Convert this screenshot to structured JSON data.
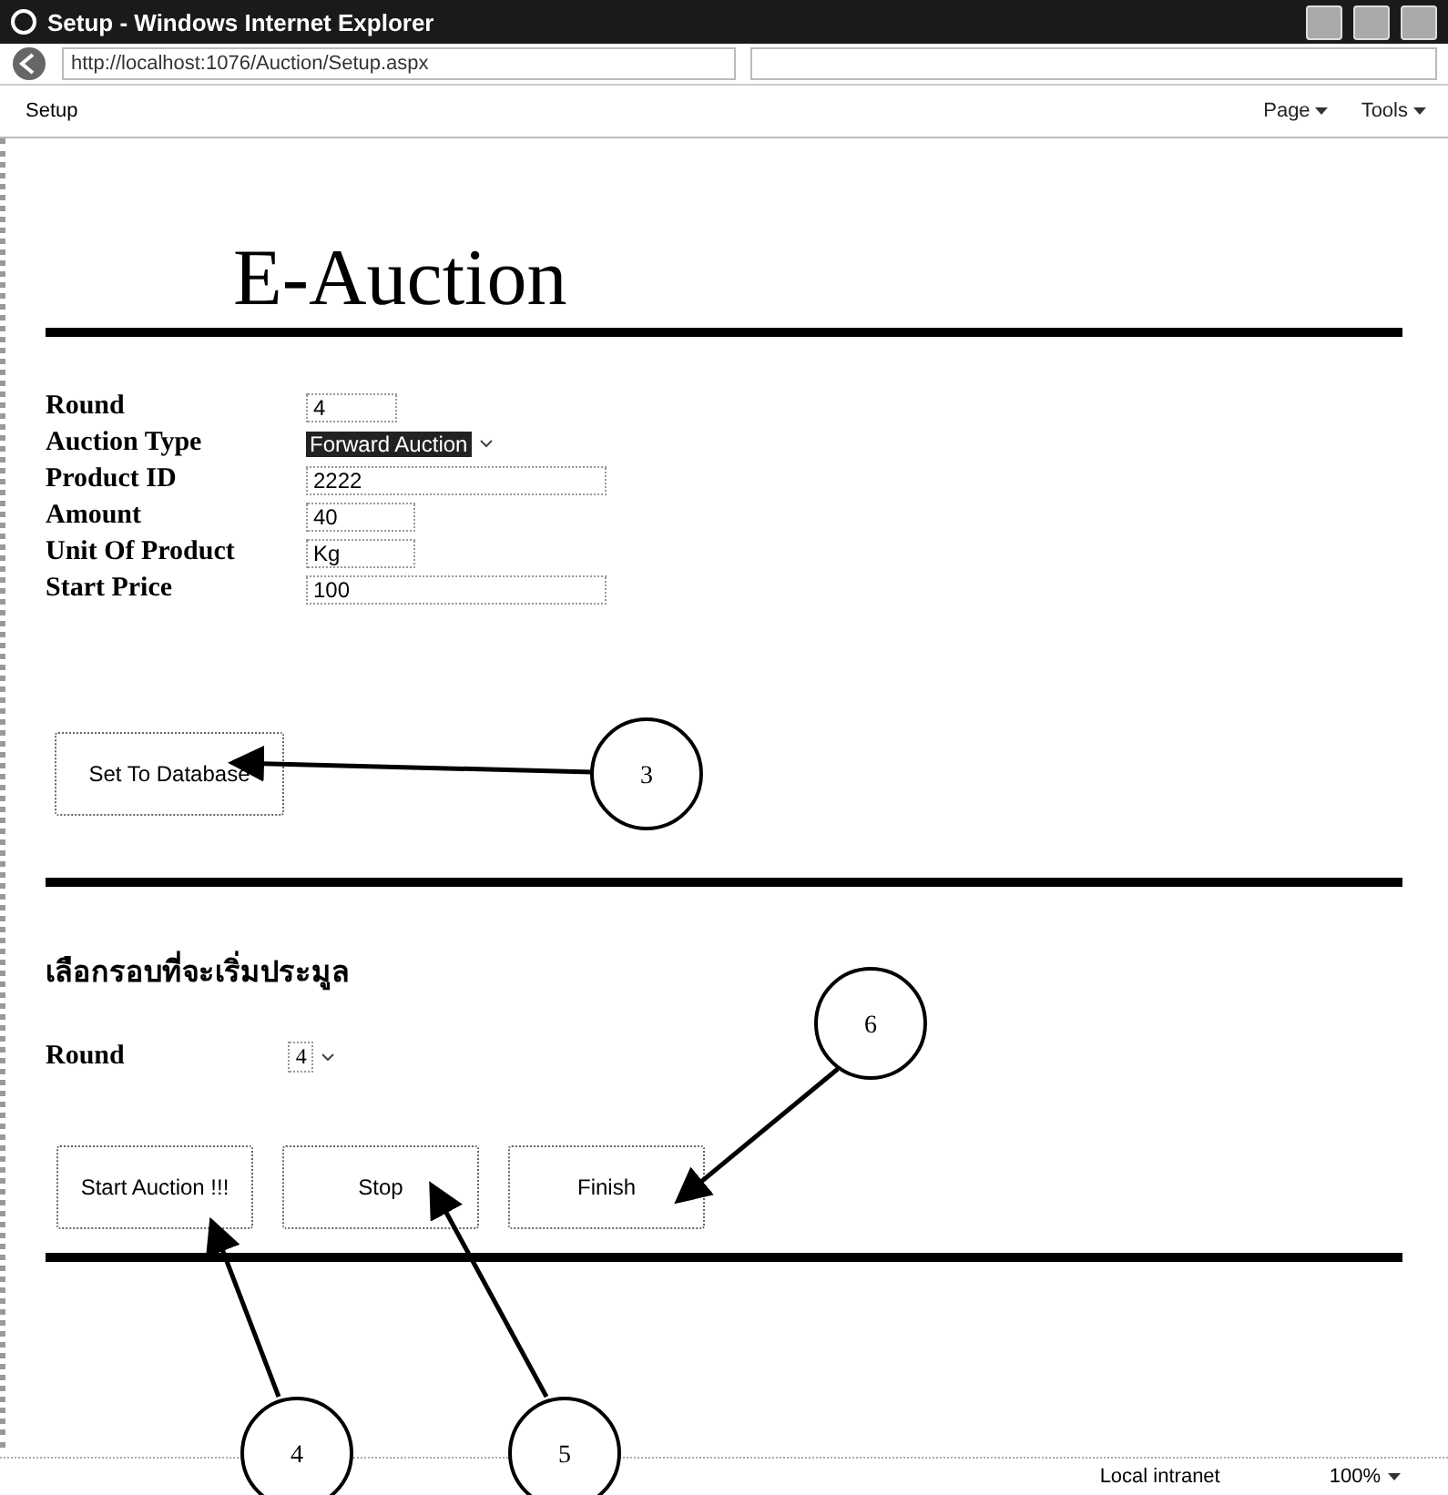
{
  "window": {
    "title": "Setup - Windows Internet Explorer"
  },
  "address_bar": {
    "url": "http://localhost:1076/Auction/Setup.aspx"
  },
  "tab": {
    "label": "Setup"
  },
  "command_bar": {
    "items": [
      "Page",
      "Tools"
    ]
  },
  "page": {
    "heading": "E-Auction",
    "form": [
      {
        "label": "Round",
        "kind": "text",
        "value": "4"
      },
      {
        "label": "Auction Type",
        "kind": "select",
        "value": "Forward Auction"
      },
      {
        "label": "Product ID",
        "kind": "text",
        "value": "2222"
      },
      {
        "label": "Amount",
        "kind": "text",
        "value": "40"
      },
      {
        "label": "Unit Of Product",
        "kind": "text",
        "value": "Kg"
      },
      {
        "label": "Start Price",
        "kind": "text",
        "value": "100"
      }
    ],
    "set_button": "Set To Database",
    "section_heading": "เลือกรอบที่จะเริ่มประมูล",
    "round": {
      "label": "Round",
      "value": "4"
    },
    "buttons": [
      "Start Auction !!!",
      "Stop",
      "Finish"
    ]
  },
  "callouts": [
    "3",
    "4",
    "5",
    "6"
  ],
  "status_bar": {
    "zone": "Local intranet",
    "zoom": "100%"
  }
}
